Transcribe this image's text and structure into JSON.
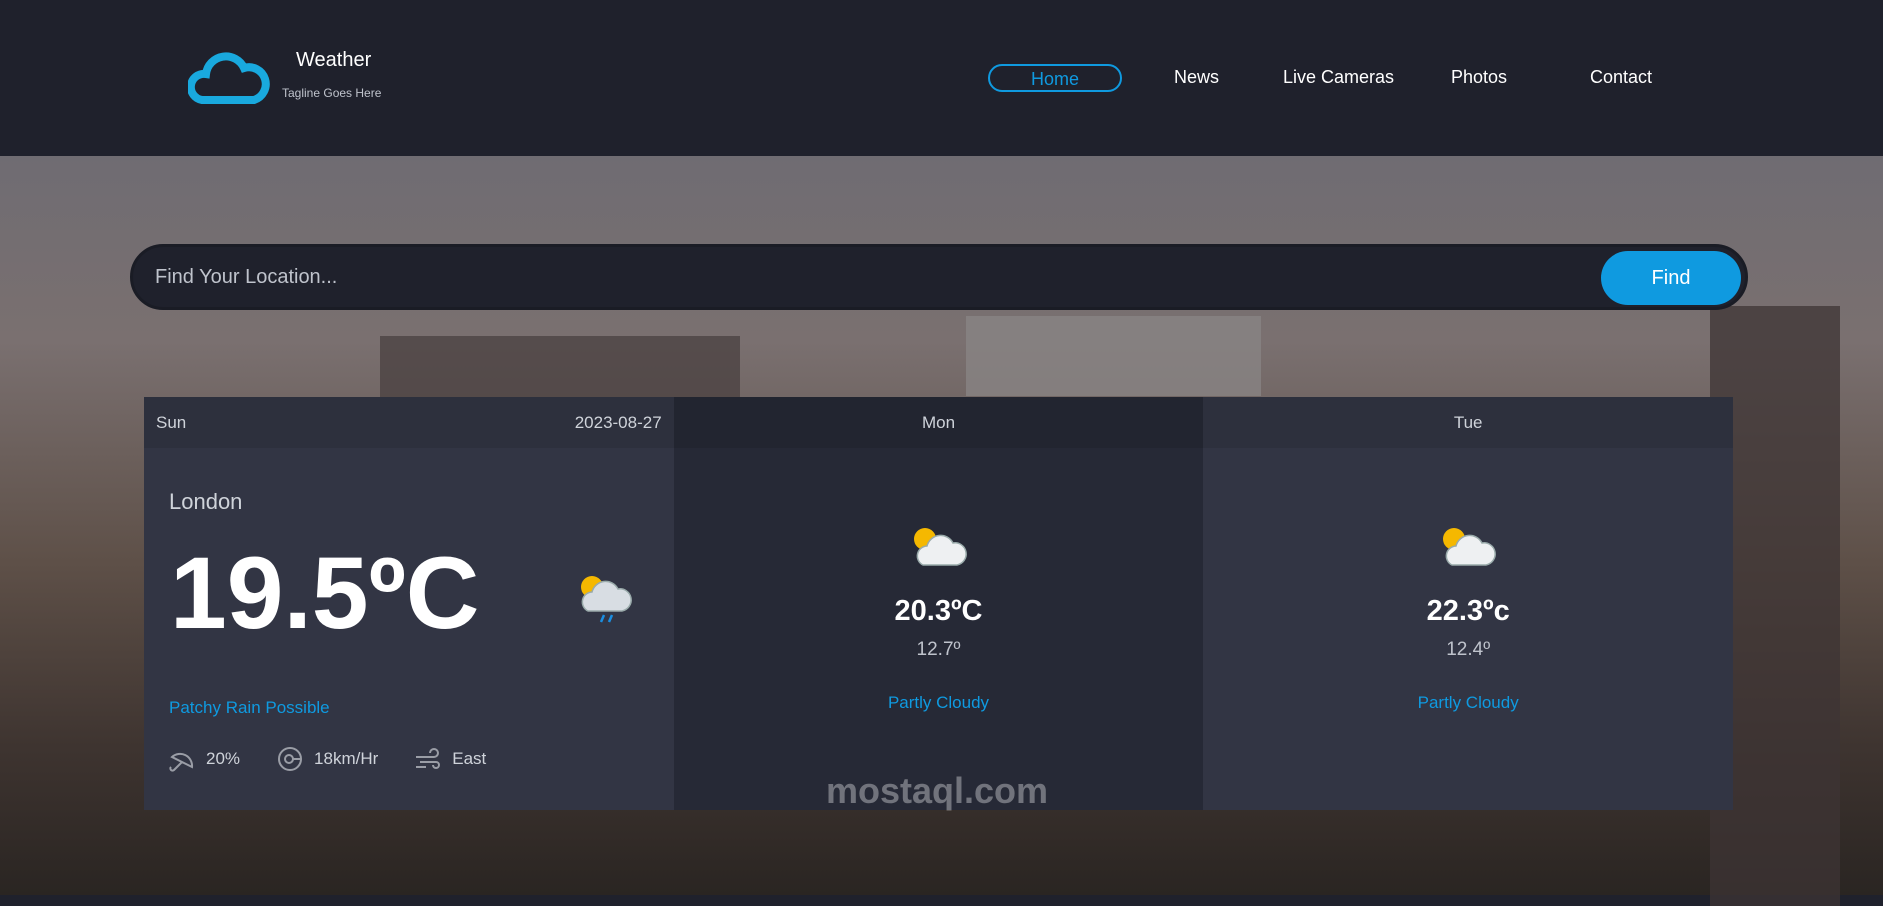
{
  "header": {
    "brand": "Weather",
    "tagline": "Tagline Goes Here",
    "nav": [
      {
        "label": "Home",
        "active": true
      },
      {
        "label": "News"
      },
      {
        "label": "Live Cameras"
      },
      {
        "label": "Photos"
      },
      {
        "label": "Contact"
      }
    ]
  },
  "search": {
    "placeholder": "Find Your Location...",
    "button": "Find"
  },
  "today": {
    "day": "Sun",
    "date": "2023-08-27",
    "city": "London",
    "temp": "19.5ºC",
    "condition": "Patchy Rain Possible",
    "rain": "20%",
    "wind_speed": "18km/Hr",
    "wind_dir": "East"
  },
  "forecast": [
    {
      "day": "Mon",
      "max": "20.3ºC",
      "min": "12.7º",
      "condition": "Partly Cloudy"
    },
    {
      "day": "Tue",
      "max": "22.3ºc",
      "min": "12.4º",
      "condition": "Partly Cloudy"
    }
  ],
  "watermark": "mostaql.com",
  "colors": {
    "accent": "#0f9ae0",
    "header": "#1f212c"
  }
}
